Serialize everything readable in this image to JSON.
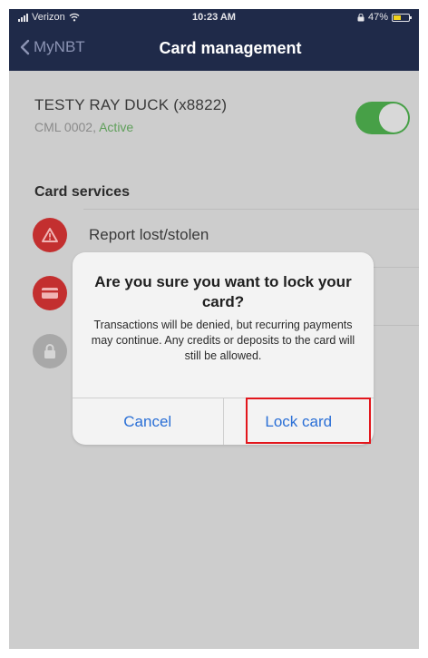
{
  "status": {
    "carrier": "Verizon",
    "time": "10:23 AM",
    "battery": "47%"
  },
  "nav": {
    "back_label": "MyNBT",
    "title": "Card management"
  },
  "card": {
    "name": "TESTY RAY DUCK (x8822)",
    "code": "CML 0002,",
    "status": "Active",
    "toggle_on": true
  },
  "services": {
    "title": "Card services",
    "items": [
      {
        "label": "Report lost/stolen",
        "icon": "warning-icon"
      },
      {
        "label": "",
        "icon": "card-icon"
      },
      {
        "label": "",
        "icon": "lock-icon"
      }
    ]
  },
  "dialog": {
    "title": "Are you sure you want to lock your card?",
    "message": "Transactions will be denied, but recurring payments may continue. Any credits or deposits to the card will still be allowed.",
    "cancel_label": "Cancel",
    "confirm_label": "Lock card"
  },
  "colors": {
    "nav_bg": "#1f2a49",
    "toggle_on": "#47a047",
    "icon_red": "#c32f2f",
    "link_blue": "#2a6fd6",
    "highlight": "#e2161c"
  }
}
